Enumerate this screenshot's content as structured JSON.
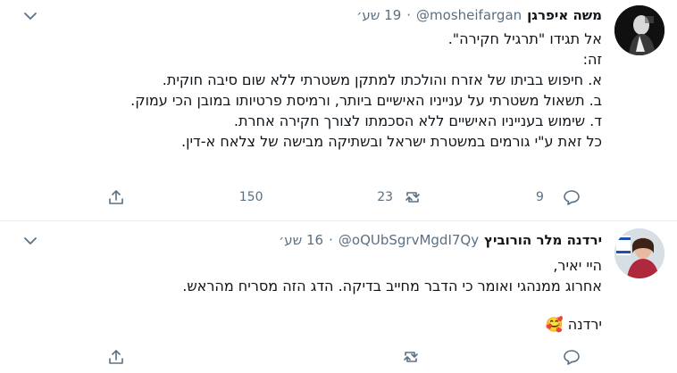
{
  "tweets": [
    {
      "name": "משה איפרגן",
      "handle": "@mosheifargan",
      "dot": "·",
      "time": "19 שע׳",
      "lines": [
        "אל תגידו \"תרגיל חקירה\".",
        "זה:",
        "א. חיפוש בביתו של אזרח והולכתו למתקן משטרתי ללא שום סיבה חוקית.",
        "ב. תשאול משטרתי על ענייניו האישיים ביותר, ורמיסת פרטיותו במובן הכי עמוק.",
        "ד. שימוש בענייניו האישיים ללא הסכמתו לצורך חקירה אחרת.",
        "כל זאת ע\"י גורמים במשטרת ישראל ובשתיקה מבישה של צלאח א-דין."
      ],
      "counts": {
        "reply": "9",
        "retweet": "23",
        "like": "150"
      }
    },
    {
      "name": "ירדנה מלר הורוביץ",
      "handle": "@oQUbSgrvMgdI7Qy",
      "dot": "·",
      "time": "16 שע׳",
      "lines": [
        "היי יאיר,",
        "אחרוג ממנהגי ואומר כי הדבר מחייב בדיקה. הדג הזה מסריח מהראש.",
        "",
        "ירדנה"
      ],
      "emoji": "🥰",
      "counts": {
        "reply": "",
        "retweet": "",
        "like": ""
      }
    }
  ],
  "icons": [
    "chevron-down-icon",
    "reply-icon",
    "retweet-icon",
    "like-icon",
    "share-icon"
  ],
  "colors": {
    "text": "#0f1419",
    "secondary": "#5b7083",
    "divider": "#e6ecf0"
  }
}
